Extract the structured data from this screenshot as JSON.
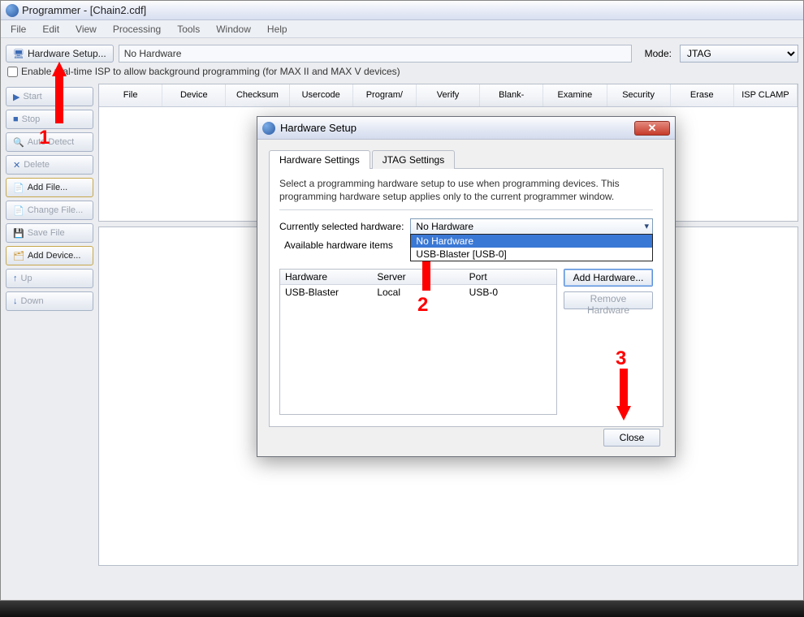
{
  "window": {
    "title": "Programmer - [Chain2.cdf]"
  },
  "menubar": [
    "File",
    "Edit",
    "View",
    "Processing",
    "Tools",
    "Window",
    "Help"
  ],
  "toolbar": {
    "hardware_setup_label": "Hardware Setup...",
    "current_hw": "No Hardware",
    "mode_label": "Mode:",
    "mode_value": "JTAG"
  },
  "isp_checkbox": "Enable real-time ISP to allow background programming (for MAX II and MAX V devices)",
  "sidebar": {
    "start": "Start",
    "stop": "Stop",
    "auto_detect": "Auto Detect",
    "delete": "Delete",
    "add_file": "Add File...",
    "change_file": "Change File...",
    "save_file": "Save File",
    "add_device": "Add Device...",
    "up": "Up",
    "down": "Down"
  },
  "grid_headers": [
    "File",
    "Device",
    "Checksum",
    "Usercode",
    "Program/",
    "Verify",
    "Blank-",
    "Examine",
    "Security",
    "Erase",
    "ISP CLAMP"
  ],
  "dialog": {
    "title": "Hardware Setup",
    "tab_hw": "Hardware Settings",
    "tab_jtag": "JTAG Settings",
    "description": "Select a programming hardware setup to use when programming devices. This programming hardware setup applies only to the current programmer window.",
    "sel_label": "Currently selected hardware:",
    "sel_value": "No Hardware",
    "dropdown_opt0": "No Hardware",
    "dropdown_opt1": "USB-Blaster [USB-0]",
    "avail_label": "Available hardware items",
    "col_hw": "Hardware",
    "col_server": "Server",
    "col_port": "Port",
    "row_hw": "USB-Blaster",
    "row_server": "Local",
    "row_port": "USB-0",
    "btn_add": "Add Hardware...",
    "btn_remove": "Remove Hardware",
    "btn_close": "Close"
  },
  "annotations": {
    "n1": "1",
    "n2": "2",
    "n3": "3"
  }
}
